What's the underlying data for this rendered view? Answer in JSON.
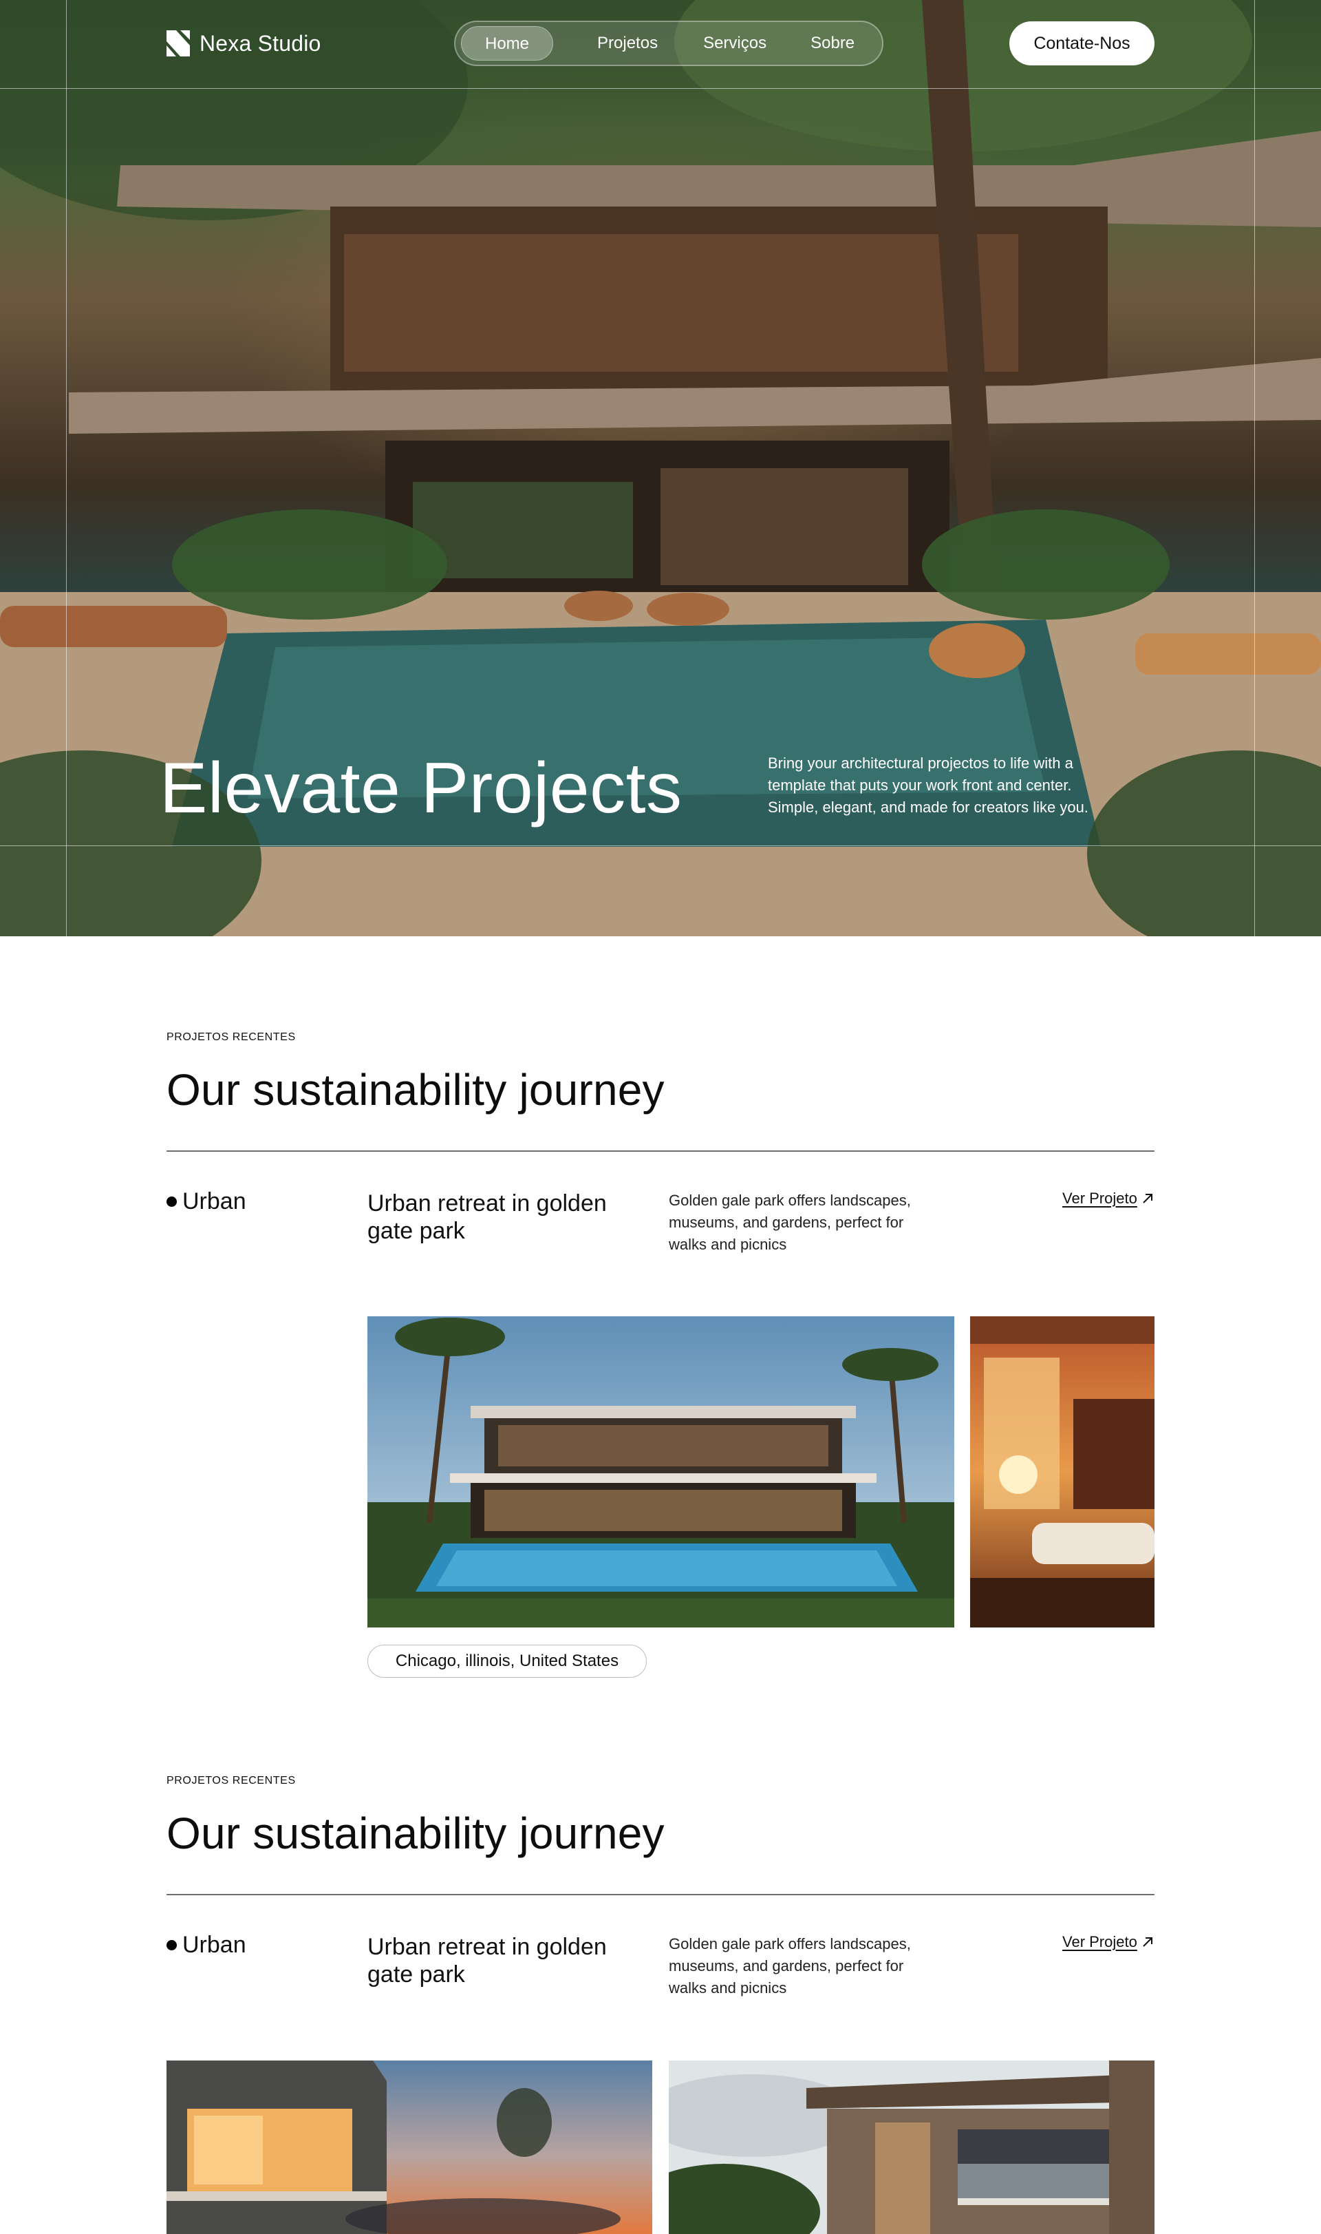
{
  "brand": {
    "name": "Nexa Studio"
  },
  "nav": {
    "items": [
      {
        "label": "Home",
        "active": true
      },
      {
        "label": "Projetos",
        "active": false
      },
      {
        "label": "Serviços",
        "active": false
      },
      {
        "label": "Sobre",
        "active": false
      }
    ],
    "cta": "Contate-Nos"
  },
  "hero": {
    "title": "Elevate Projects",
    "description": "Bring your architectural projectos to life with a template that puts your work front and center. Simple, elegant, and made for creators like you."
  },
  "sections": [
    {
      "eyebrow": "PROJETOS RECENTES",
      "title": "Our sustainability journey",
      "category": "Urban",
      "project_title": "Urban retreat in golden gate park",
      "project_description": "Golden gale park offers landscapes, museums, and gardens, perfect for walks and picnics",
      "link_label": "Ver Projeto",
      "location": "Chicago, illinois, United States"
    },
    {
      "eyebrow": "PROJETOS RECENTES",
      "title": "Our sustainability journey",
      "category": "Urban",
      "project_title": "Urban retreat in golden gate park",
      "project_description": "Golden gale park offers landscapes, museums, and gardens, perfect for walks and picnics",
      "link_label": "Ver Projeto"
    }
  ],
  "icons": {
    "logo": "logo-mark-icon",
    "link_arrow": "arrow-up-right-icon",
    "category_dot": "bullet-dot-icon"
  }
}
